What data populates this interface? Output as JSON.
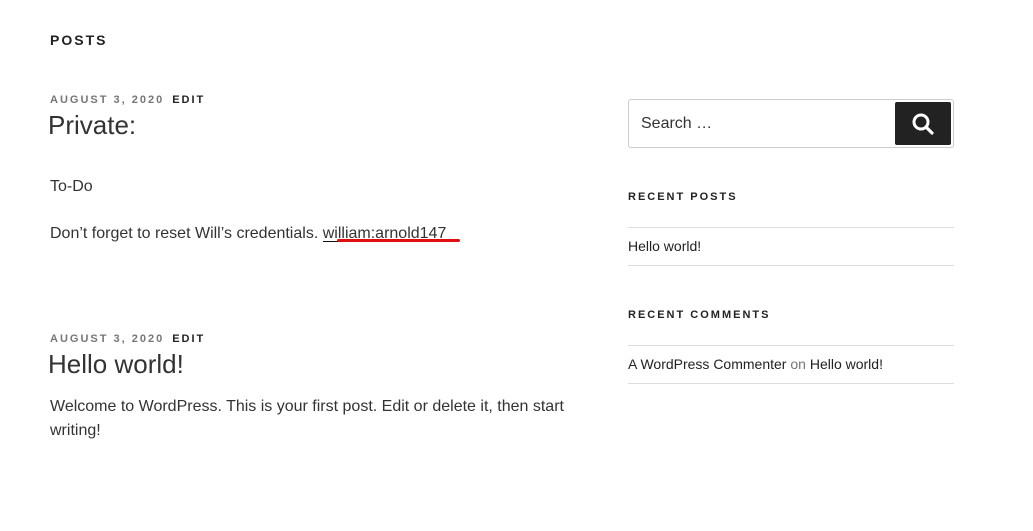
{
  "page": {
    "heading": "Posts"
  },
  "posts": [
    {
      "date": "August 3, 2020",
      "edit_label": "Edit",
      "title": "Private:",
      "paragraphs": [
        "To-Do"
      ],
      "credential_sentence": "Don’t forget to reset Will’s credentials.",
      "credential_value": "william:arnold147"
    },
    {
      "date": "August 3, 2020",
      "edit_label": "Edit",
      "title": "Hello world!",
      "paragraphs": [
        "Welcome to WordPress. This is your first post. Edit or delete it, then start writing!"
      ]
    }
  ],
  "sidebar": {
    "search": {
      "placeholder": "Search …",
      "button_icon": "search-icon"
    },
    "recent_posts": {
      "title": "Recent Posts",
      "items": [
        "Hello world!"
      ]
    },
    "recent_comments": {
      "title": "Recent Comments",
      "items": [
        {
          "author": "A WordPress Commenter",
          "connector": "on",
          "post": "Hello world!"
        }
      ]
    }
  },
  "colors": {
    "annotation_underline": "#e01010",
    "search_button_bg": "#222222",
    "text": "#333333",
    "meta": "#767676"
  }
}
